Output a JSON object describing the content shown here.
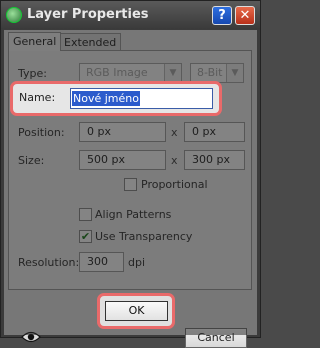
{
  "window": {
    "title": "Layer Properties",
    "help_label": "?",
    "close_label": "✕"
  },
  "tabs": [
    {
      "label": "General"
    },
    {
      "label": "Extended"
    }
  ],
  "type": {
    "label": "Type:",
    "value": "RGB Image",
    "depth": "8-Bit"
  },
  "name": {
    "label": "Name:",
    "value": "Nové jméno"
  },
  "position": {
    "label": "Position:",
    "x": "0 px",
    "sep": "x",
    "y": "0 px"
  },
  "size": {
    "label": "Size:",
    "w": "500 px",
    "sep": "x",
    "h": "300 px"
  },
  "proportional": {
    "label": "Proportional",
    "checked": false
  },
  "align_patterns": {
    "label": "Align Patterns",
    "checked": false
  },
  "use_transparency": {
    "label": "Use Transparency",
    "checked": true
  },
  "resolution": {
    "label": "Resolution:",
    "value": "300",
    "unit": "dpi"
  },
  "buttons": {
    "ok": "OK",
    "cancel": "Cancel"
  },
  "icons": {
    "visibility": "eye-icon",
    "app": "app-logo-icon"
  },
  "colors": {
    "highlight": "#e96a6a",
    "selection": "#2b5bcc"
  }
}
